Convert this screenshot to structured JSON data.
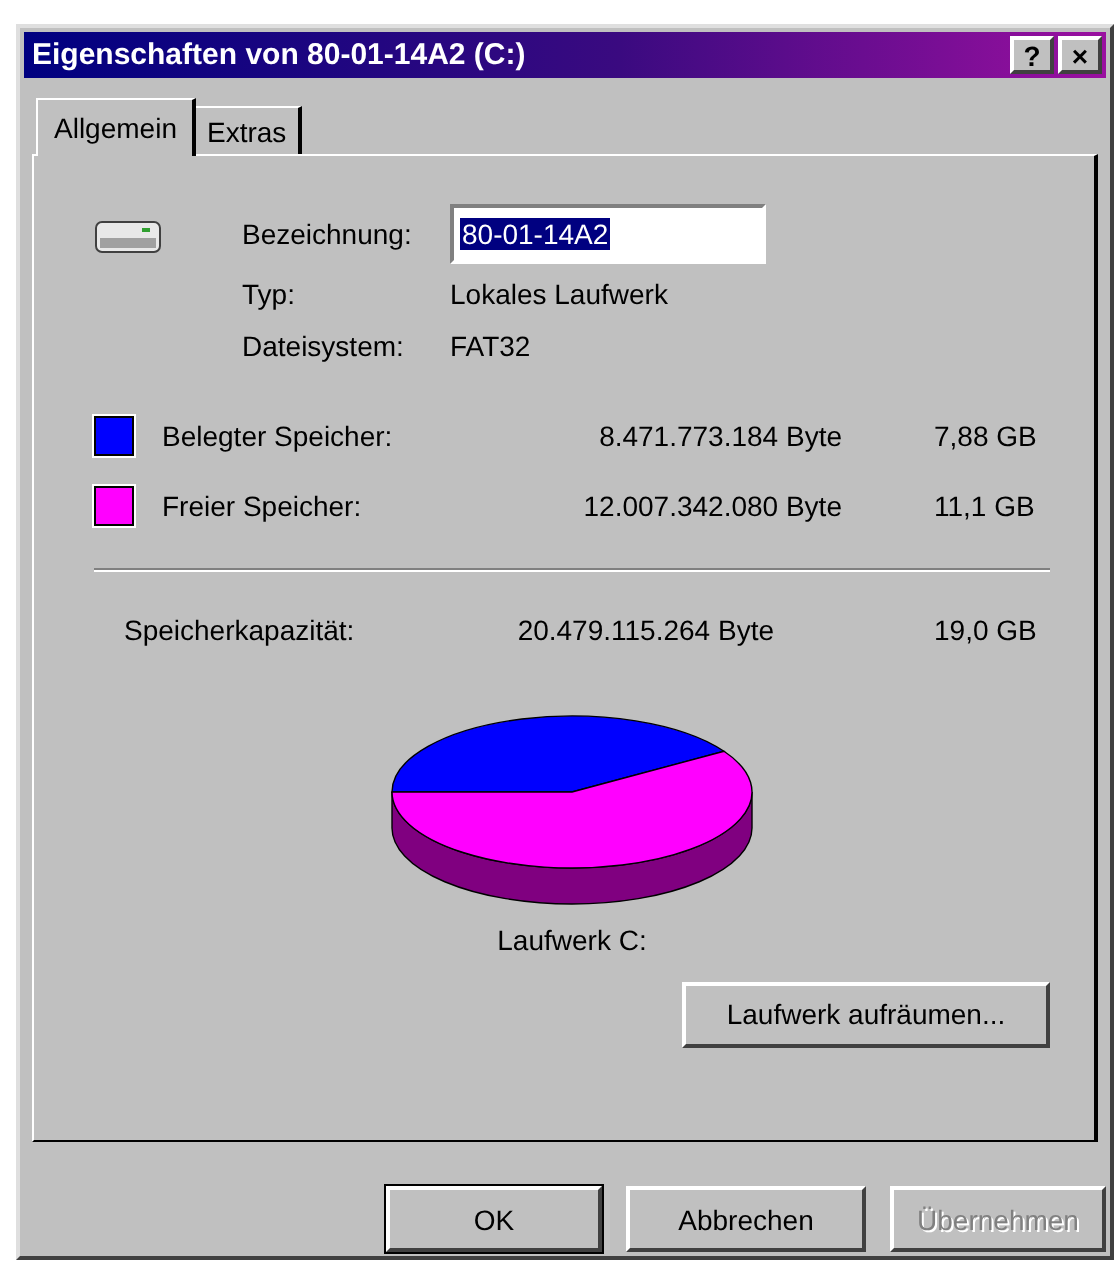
{
  "window": {
    "title": "Eigenschaften von 80-01-14A2 (C:)",
    "help_button": "?",
    "close_button": "×"
  },
  "tabs": [
    {
      "label": "Allgemein",
      "selected": true
    },
    {
      "label": "Extras",
      "selected": false
    }
  ],
  "label_field": {
    "label": "Bezeichnung:",
    "value": "80-01-14A2"
  },
  "info": [
    {
      "label": "Typ:",
      "value": "Lokales Laufwerk"
    },
    {
      "label": "Dateisystem:",
      "value": "FAT32"
    }
  ],
  "usage": [
    {
      "label": "Belegter Speicher:",
      "bytes": "8.471.773.184 Byte",
      "size": "7,88 GB",
      "color": "#0000ff"
    },
    {
      "label": "Freier Speicher:",
      "bytes": "12.007.342.080 Byte",
      "size": "11,1 GB",
      "color": "#ff00ff"
    }
  ],
  "capacity": {
    "label": "Speicherkapazität:",
    "bytes": "20.479.115.264 Byte",
    "size": "19,0 GB"
  },
  "drive_chart": {
    "caption": "Laufwerk C:"
  },
  "cleanup_button": "Laufwerk aufräumen...",
  "buttons": [
    {
      "label": "OK",
      "disabled": false
    },
    {
      "label": "Abbrechen",
      "disabled": false
    },
    {
      "label": "Übernehmen",
      "disabled": true
    }
  ]
}
